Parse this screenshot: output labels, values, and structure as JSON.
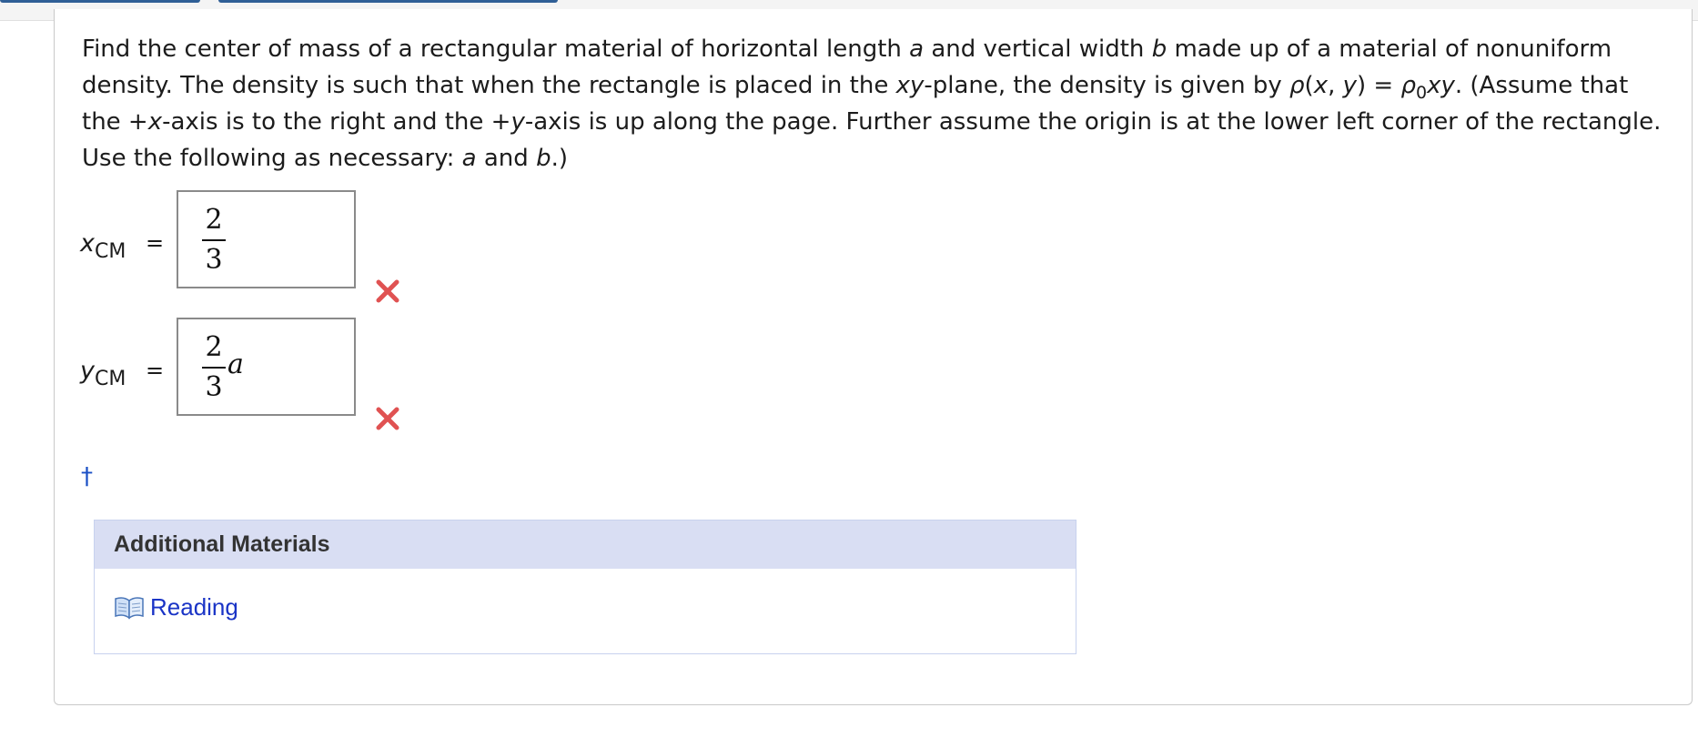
{
  "question": {
    "p1": "Find the center of mass of a rectangular material of horizontal length ",
    "var_a": "a",
    "p2": " and vertical width ",
    "var_b": "b",
    "p3": " made up of a material of nonuniform density. The density is such that when the rectangle is placed in the ",
    "var_xy": "xy",
    "p4": "-plane, the density is given by ",
    "rho": "ρ",
    "p5": "(",
    "var_x": "x",
    "p6": ", ",
    "var_y": "y",
    "p7": ") = ",
    "rho0": "ρ",
    "rho0_sub": "0",
    "var_xy2": "xy",
    "p8": ". (Assume that the +",
    "var_x2": "x",
    "p9": "-axis is to the right and the +",
    "var_y2": "y",
    "p10": "-axis is up along the page. Further assume the origin is at the lower left corner of the rectangle. Use the following as necessary: ",
    "var_a2": "a",
    "p11": " and ",
    "var_b2": "b",
    "p12": ".)"
  },
  "answers": [
    {
      "var": "x",
      "sub": "CM",
      "equals": "=",
      "numerator": "2",
      "denominator": "3",
      "suffix": "",
      "status": "incorrect"
    },
    {
      "var": "y",
      "sub": "CM",
      "equals": "=",
      "numerator": "2",
      "denominator": "3",
      "suffix": "a",
      "status": "incorrect"
    }
  ],
  "footnote_marker": "†",
  "additional_materials": {
    "title": "Additional Materials",
    "items": [
      {
        "icon": "book-icon",
        "label": "Reading"
      }
    ]
  },
  "colors": {
    "incorrect_mark": "#e05252",
    "link": "#1a34c6",
    "materials_header_bg": "#d9def3"
  }
}
